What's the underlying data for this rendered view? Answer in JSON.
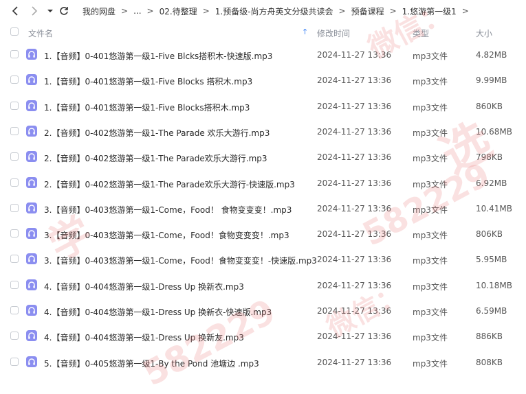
{
  "breadcrumb": [
    "我的网盘",
    "...",
    "02.待整理",
    "1.预备级-尚方舟英文分级共读会",
    "预备课程",
    "1.悠游第一级1"
  ],
  "breadcrumb_sep": ">",
  "header": {
    "name": "文件名",
    "modified": "修改时间",
    "type": "类型",
    "size": "大小"
  },
  "files": [
    {
      "name": "1.【音频】0-401悠游第一级1-Five Blcks搭积木-快速版.mp3",
      "time": "2024-11-27 13:36",
      "type": "mp3文件",
      "size": "4.82MB"
    },
    {
      "name": "1.【音频】0-401悠游第一级1-Five Blocks 搭积木.mp3",
      "time": "2024-11-27 13:36",
      "type": "mp3文件",
      "size": "9.99MB"
    },
    {
      "name": "1.【音频】0-401悠游第一级1-Five Blocks搭积木.mp3",
      "time": "2024-11-27 13:36",
      "type": "mp3文件",
      "size": "860KB"
    },
    {
      "name": "2.【音频】0-402悠游第一级1-The Parade 欢乐大游行.mp3",
      "time": "2024-11-27 13:36",
      "type": "mp3文件",
      "size": "10.68MB"
    },
    {
      "name": "2.【音频】0-402悠游第一级1-The Parade欢乐大游行.mp3",
      "time": "2024-11-27 13:36",
      "type": "mp3文件",
      "size": "798KB"
    },
    {
      "name": "2.【音频】0-402悠游第一级1-The Parade欢乐大游行-快速版.mp3",
      "time": "2024-11-27 13:36",
      "type": "mp3文件",
      "size": "6.92MB"
    },
    {
      "name": "3.【音频】0-403悠游第一级1-Come，Food！ 食物变变变！.mp3",
      "time": "2024-11-27 13:36",
      "type": "mp3文件",
      "size": "10.41MB"
    },
    {
      "name": "3.【音频】0-403悠游第一级1-Come，Food！食物变变变！.mp3",
      "time": "2024-11-27 13:36",
      "type": "mp3文件",
      "size": "806KB"
    },
    {
      "name": "3.【音频】0-403悠游第一级1-Come，Food！食物变变变！-快速版.mp3",
      "time": "2024-11-27 13:36",
      "type": "mp3文件",
      "size": "5.95MB"
    },
    {
      "name": "4.【音频】0-404悠游第一级1-Dress Up 换新衣.mp3",
      "time": "2024-11-27 13:36",
      "type": "mp3文件",
      "size": "10.18MB"
    },
    {
      "name": "4.【音频】0-404悠游第一级1-Dress Up 换新衣-快速版.mp3",
      "time": "2024-11-27 13:36",
      "type": "mp3文件",
      "size": "6.59MB"
    },
    {
      "name": "4.【音频】0-404悠游第一级1-Dress Up 换新友.mp3",
      "time": "2024-11-27 13:36",
      "type": "mp3文件",
      "size": "886KB"
    },
    {
      "name": "5.【音频】0-405悠游第一级1-By the Pond 池塘边 .mp3",
      "time": "2024-11-27 13:36",
      "type": "mp3文件",
      "size": "808KB"
    }
  ],
  "watermarks": [
    "微信：",
    "582229",
    "学",
    "选",
    "微信：",
    "582229"
  ],
  "colors": {
    "accent": "#3b82f6",
    "file_icon": "#8b8ef0"
  },
  "icons": {
    "back": "back-arrow-icon",
    "forward": "forward-arrow-icon",
    "dropdown": "caret-down-icon",
    "refresh": "refresh-icon",
    "audio": "headphones-icon"
  }
}
